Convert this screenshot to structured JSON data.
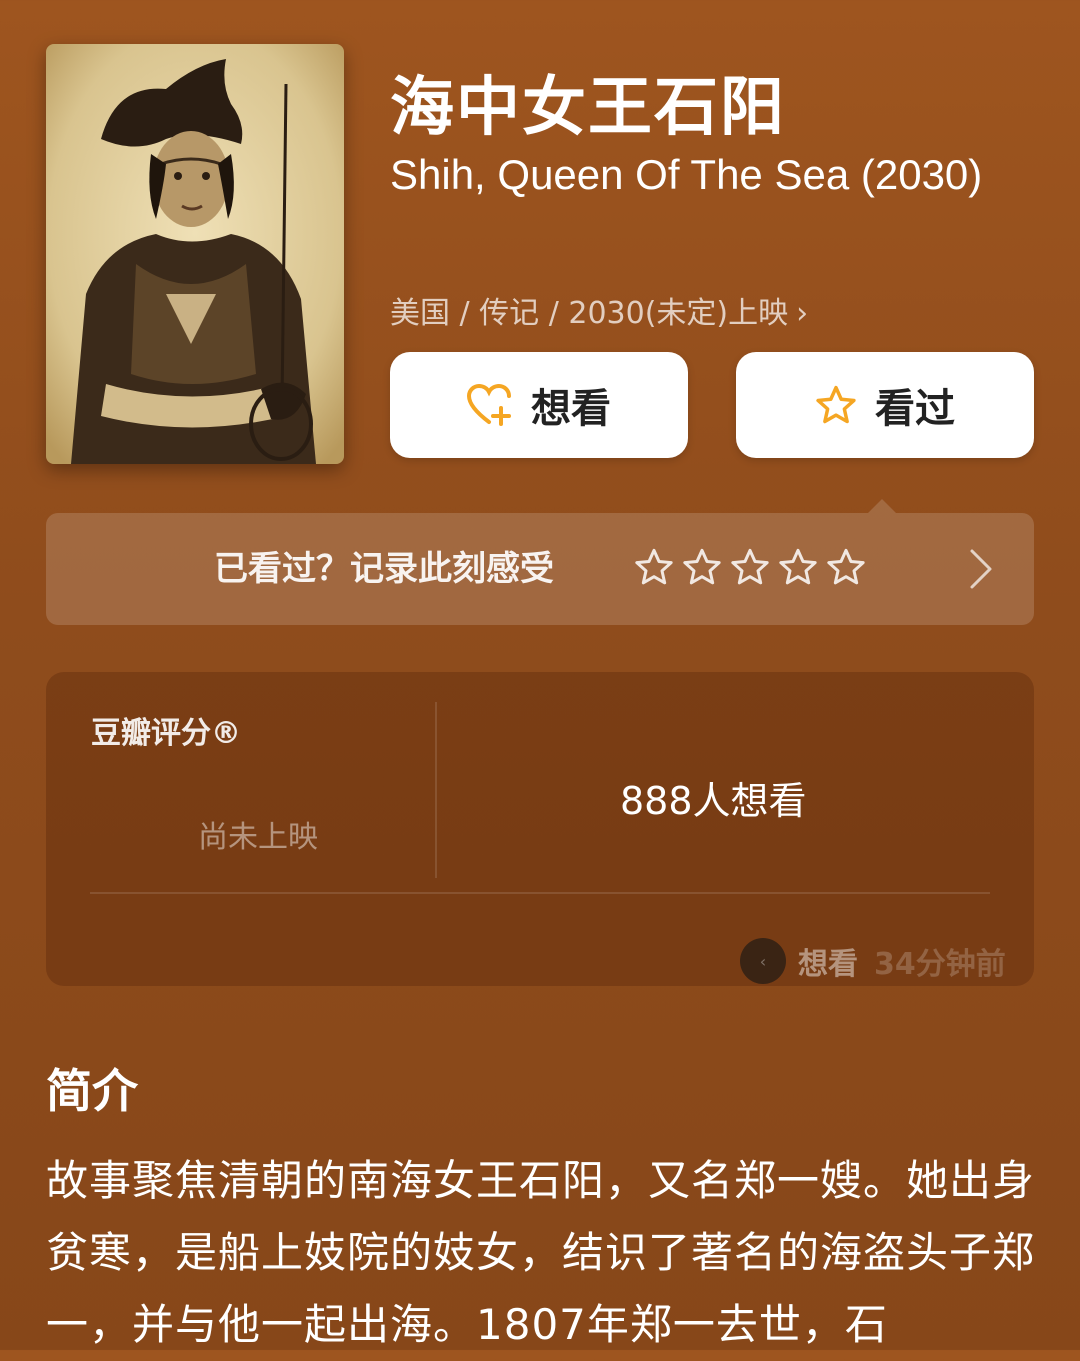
{
  "movie": {
    "title_cn": "海中女王石阳",
    "title_en": "Shih, Queen Of The Sea (2030)",
    "meta": "美国 / 传记 / 2030(未定)上映",
    "meta_chevron": "›"
  },
  "actions": {
    "want_label": "想看",
    "seen_label": "看过"
  },
  "rating_prompt": {
    "text": "已看过？记录此刻感受",
    "stars": 5
  },
  "score": {
    "label": "豆瓣评分®",
    "status": "尚未上映",
    "want_count": "888人想看",
    "activity_action": "想看",
    "activity_time": "34分钟前"
  },
  "synopsis": {
    "title": "简介",
    "text": "故事聚焦清朝的南海女王石阳，又名郑一嫂。她出身贫寒，是船上妓院的妓女，结识了著名的海盗头子郑一，并与他一起出海。1807年郑一去世，石"
  },
  "colors": {
    "background": "#9a521e",
    "accent_orange": "#f5a623",
    "button_bg": "#ffffff"
  }
}
